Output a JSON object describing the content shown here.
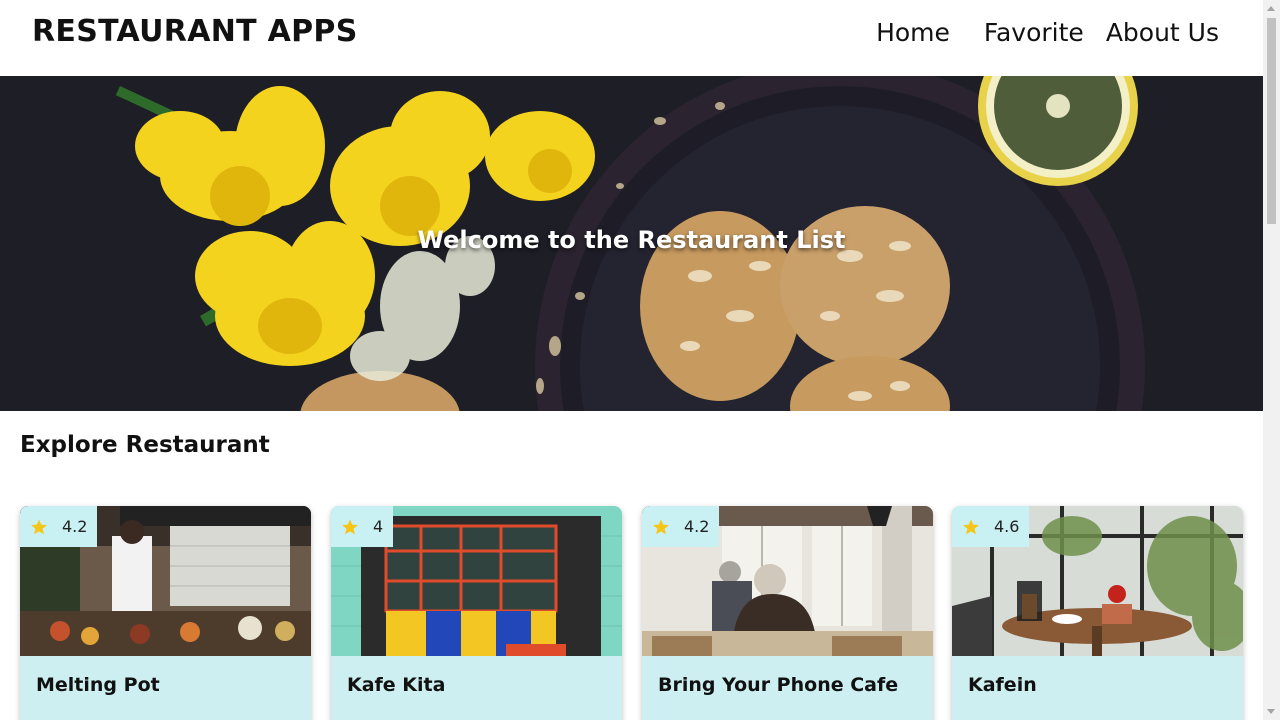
{
  "header": {
    "brand": "RESTAURANT APPS",
    "nav": [
      {
        "label": "Home"
      },
      {
        "label": "Favorite"
      },
      {
        "label": "About Us"
      }
    ]
  },
  "hero": {
    "title": "Welcome to the Restaurant List"
  },
  "section": {
    "title": "Explore Restaurant"
  },
  "restaurants": [
    {
      "name": "Melting Pot",
      "rating": "4.2"
    },
    {
      "name": "Kafe Kita",
      "rating": "4"
    },
    {
      "name": "Bring Your Phone Cafe",
      "rating": "4.2"
    },
    {
      "name": "Kafein",
      "rating": "4.6"
    }
  ],
  "colors": {
    "card_bg": "#cdeff2",
    "rating_bg": "#c9f0f3",
    "star": "#f5c518"
  },
  "icons": {
    "rating": "star-icon"
  }
}
